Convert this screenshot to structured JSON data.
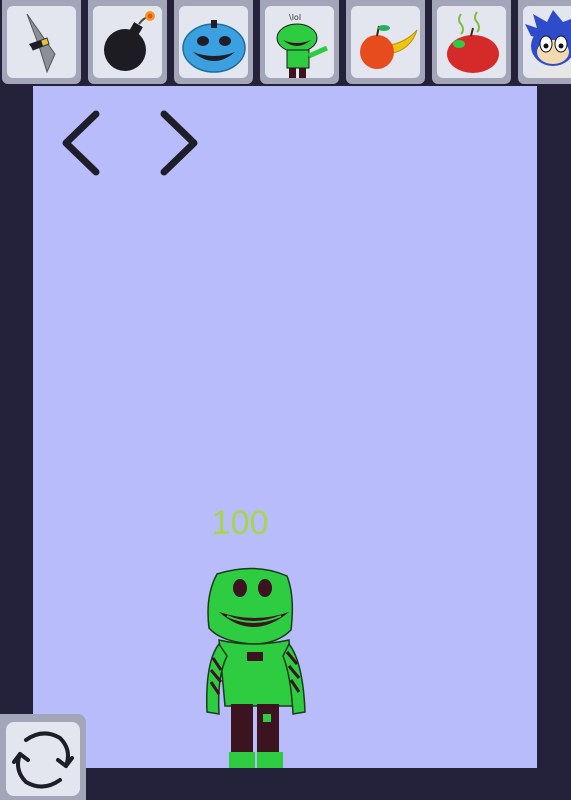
{
  "toolbar": {
    "items": [
      {
        "name": "knife",
        "icon": "knife-icon"
      },
      {
        "name": "bomb",
        "icon": "bomb-icon"
      },
      {
        "name": "blue-pumpkin",
        "icon": "blue-pumpkin-icon"
      },
      {
        "name": "green-monster",
        "icon": "green-monster-icon",
        "caption": "\\lol"
      },
      {
        "name": "apple-banana",
        "icon": "apple-banana-icon"
      },
      {
        "name": "rotten-apple",
        "icon": "rotten-apple-icon"
      },
      {
        "name": "blue-hedgehog",
        "icon": "blue-hedgehog-icon"
      }
    ]
  },
  "navigation": {
    "prev_icon": "chevron-left-icon",
    "next_icon": "chevron-right-icon"
  },
  "target": {
    "health": "100",
    "name": "green-monster"
  },
  "controls": {
    "reset_icon": "refresh-icon"
  },
  "colors": {
    "background": "#b8bcfa",
    "frame": "#23223a",
    "health_text": "#a7d64a",
    "monster_green": "#2ecc40",
    "monster_dark": "#3b1420"
  }
}
